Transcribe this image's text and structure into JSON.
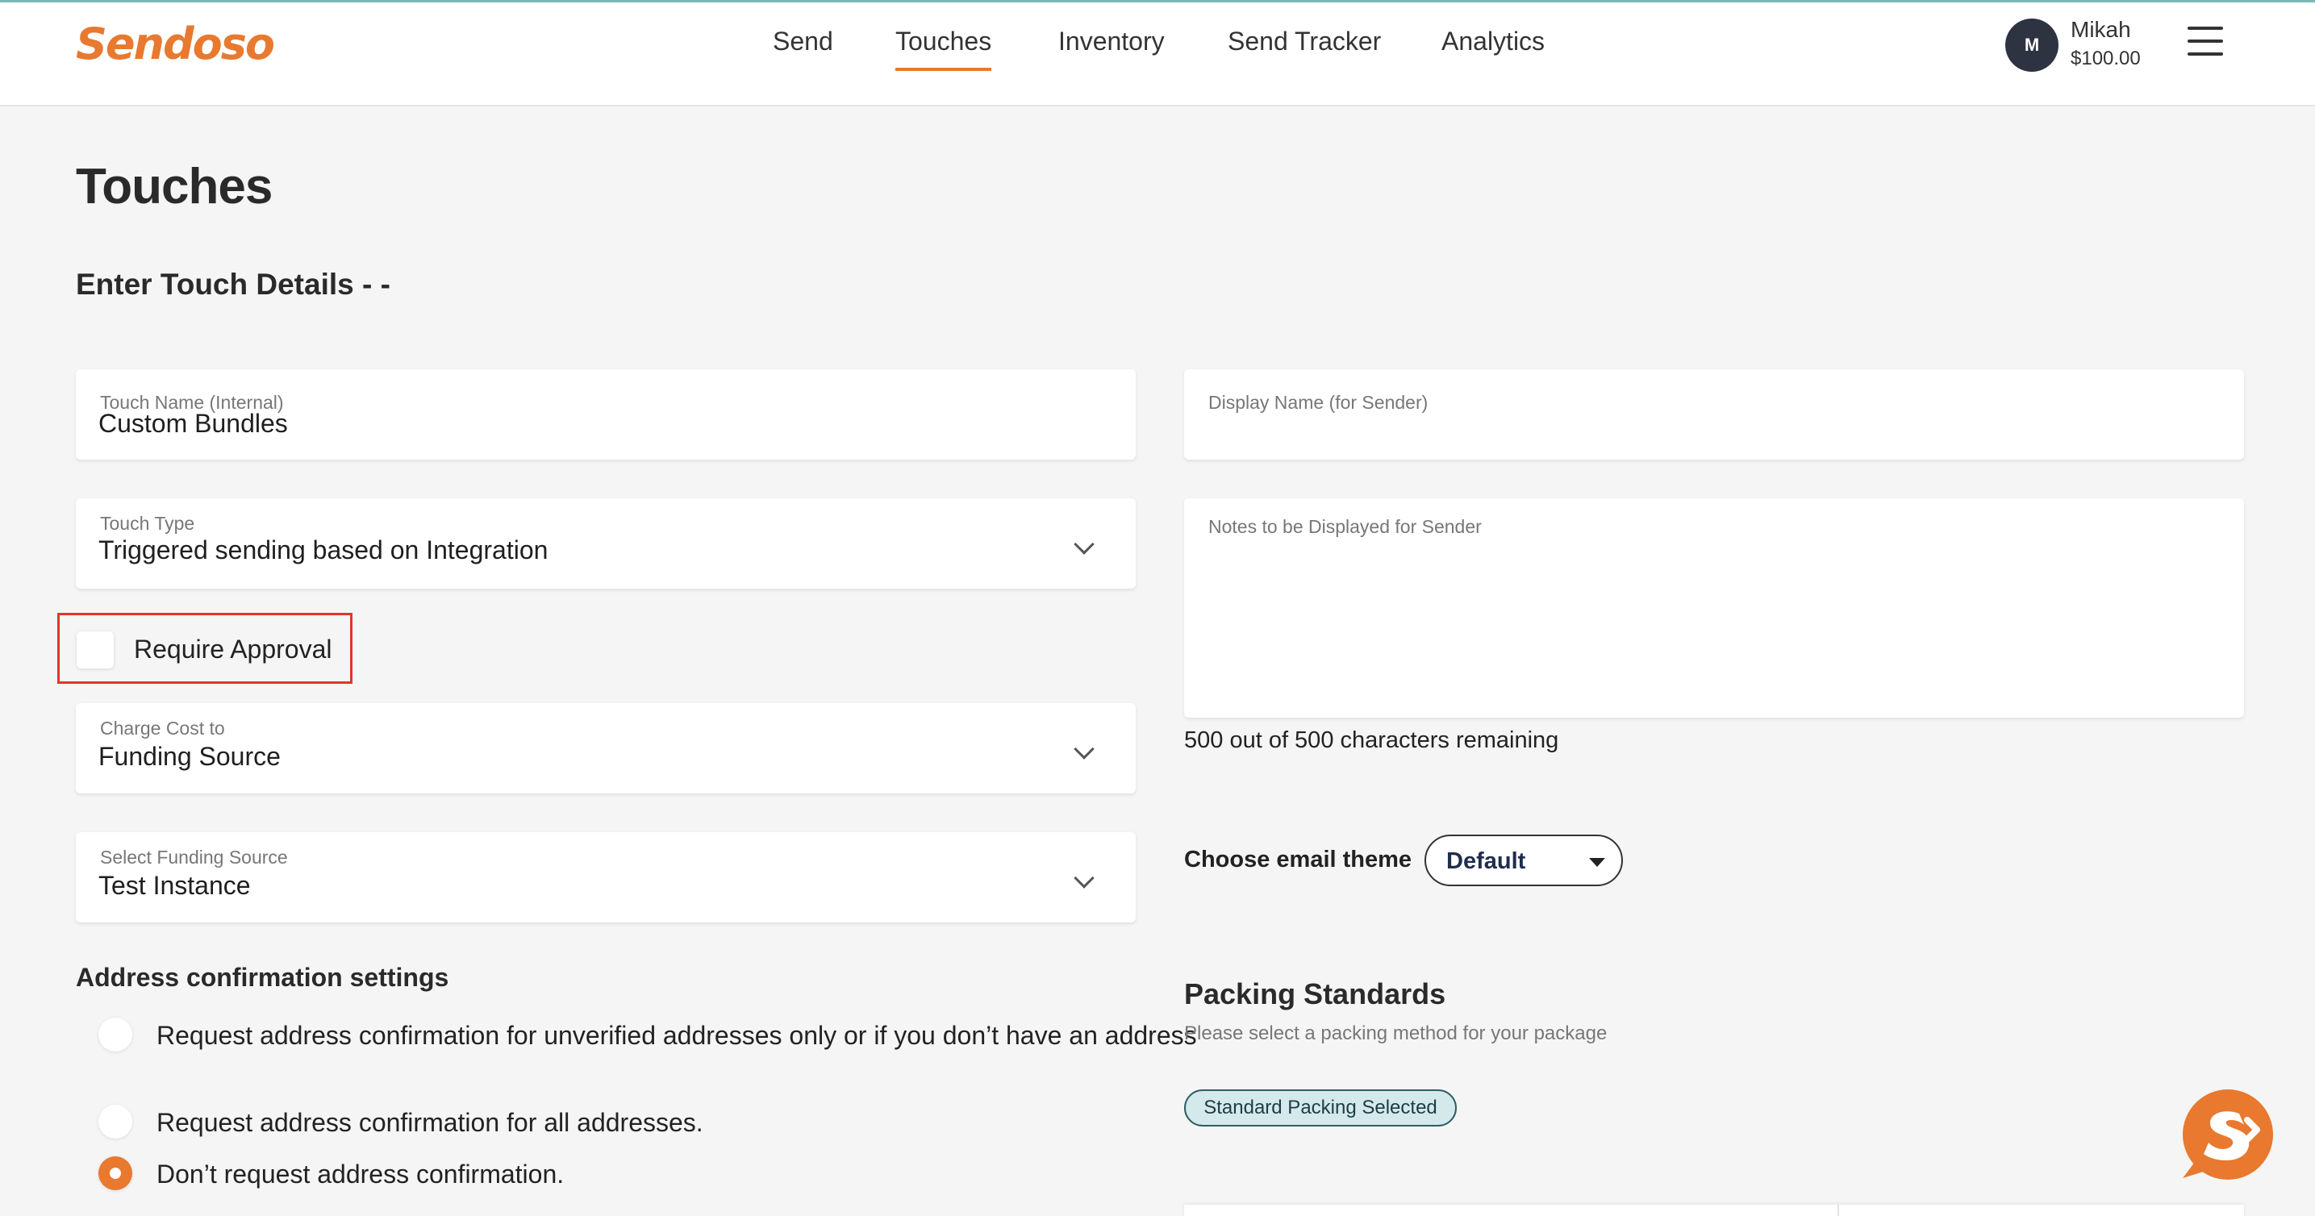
{
  "app": {
    "logo_text": "Sendoso",
    "brand_color": "#e8792f"
  },
  "nav": {
    "items": [
      {
        "label": "Send",
        "active": false
      },
      {
        "label": "Touches",
        "active": true
      },
      {
        "label": "Inventory",
        "active": false
      },
      {
        "label": "Send Tracker",
        "active": false
      },
      {
        "label": "Analytics",
        "active": false
      }
    ]
  },
  "user": {
    "initial": "M",
    "name": "Mikah",
    "balance": "$100.00"
  },
  "page": {
    "title": "Touches",
    "section_title": "Enter Touch Details - -"
  },
  "form": {
    "touch_name": {
      "label": "Touch Name (Internal)",
      "value": "Custom Bundles"
    },
    "display_name": {
      "label": "Display Name (for Sender)",
      "value": ""
    },
    "touch_type": {
      "label": "Touch Type",
      "value": "Triggered sending based on Integration"
    },
    "notes": {
      "label": "Notes to be Displayed for Sender",
      "value": ""
    },
    "require_approval": {
      "label": "Require Approval",
      "checked": false
    },
    "charge_cost_to": {
      "label": "Charge Cost to",
      "value": "Funding Source"
    },
    "funding_source": {
      "label": "Select Funding Source",
      "value": "Test Instance"
    },
    "chars_remaining": "500 out of 500 characters remaining",
    "email_theme": {
      "label": "Choose email theme",
      "value": "Default"
    }
  },
  "address_confirmation": {
    "title": "Address confirmation settings",
    "options": [
      {
        "label": "Request address confirmation for unverified addresses only or if you don’t have an address",
        "checked": false
      },
      {
        "label": "Request address confirmation for all addresses.",
        "checked": false
      },
      {
        "label": "Don’t request address confirmation.",
        "checked": true
      }
    ]
  },
  "packing": {
    "title": "Packing Standards",
    "subtitle": "Please select a packing method for your package",
    "badge": "Standard Packing Selected"
  },
  "icons": {
    "menu": "hamburger-menu-icon",
    "chevron": "chevron-down-icon",
    "caret": "caret-down-icon",
    "help": "sendoso-chat-bubble-icon"
  }
}
